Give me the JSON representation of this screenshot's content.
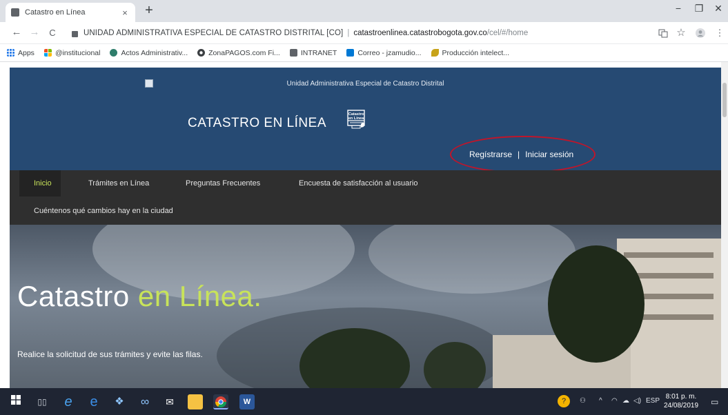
{
  "browser": {
    "tab_title": "Catastro en Línea",
    "tab_close": "×",
    "new_tab": "+",
    "window_controls": [
      "−",
      "❐",
      "✕"
    ],
    "nav": {
      "back": "←",
      "forward": "→",
      "reload": "C"
    },
    "url": {
      "org": "UNIDAD ADMINISTRATIVA ESPECIAL DE CATASTRO DISTRITAL [CO]",
      "separator": "|",
      "host": "catastroenlinea.catastrobogota.gov.co",
      "path": "/cel/#/home"
    },
    "toolbar_icons": [
      "translate-icon",
      "star-icon",
      "profile-icon",
      "menu-icon"
    ],
    "bookmarks": [
      {
        "label": "Apps",
        "icon": "apps-icon",
        "color": "#1a73e8"
      },
      {
        "label": "@institucional",
        "icon": "microsoft-icon",
        "color": "#f25022"
      },
      {
        "label": "Actos Administrativ...",
        "icon": "globe-icon",
        "color": "#2e7d6b"
      },
      {
        "label": "ZonaPAGOS.com Fi...",
        "icon": "chrome-icon",
        "color": "#3c4043"
      },
      {
        "label": "INTRANET",
        "icon": "intranet-icon",
        "color": "#5f6368"
      },
      {
        "label": "Correo - jzamudio...",
        "icon": "outlook-icon",
        "color": "#0078d4"
      },
      {
        "label": "Producción intelect...",
        "icon": "leaf-icon",
        "color": "#c7a31a"
      }
    ]
  },
  "site": {
    "entity_name": "Unidad Administrativa Especial de Catastro Distrital",
    "brand": "CATASTRO EN LÍNEA",
    "logo_text_1": "Catastro",
    "logo_text_2": "en Línea",
    "register": "Regístrarse",
    "auth_separator": "|",
    "login": "Iniciar sesión",
    "accent_color": "#c8e35a",
    "header_color": "#264a73",
    "nav": [
      {
        "label": "Inicio",
        "active": true
      },
      {
        "label": "Trámites en Línea"
      },
      {
        "label": "Preguntas Frecuentes"
      },
      {
        "label": "Encuesta de satisfacción al usuario"
      },
      {
        "label": "Cuéntenos qué cambios hay en la ciudad"
      }
    ],
    "hero": {
      "title_part1": "Catastro",
      "title_part2": "en Línea.",
      "subtitle": "Realice la solicitud de sus trámites y evite las filas."
    }
  },
  "taskbar": {
    "tray_lang": "ESP",
    "time": "8:01 p. m.",
    "date": "24/08/2019"
  }
}
